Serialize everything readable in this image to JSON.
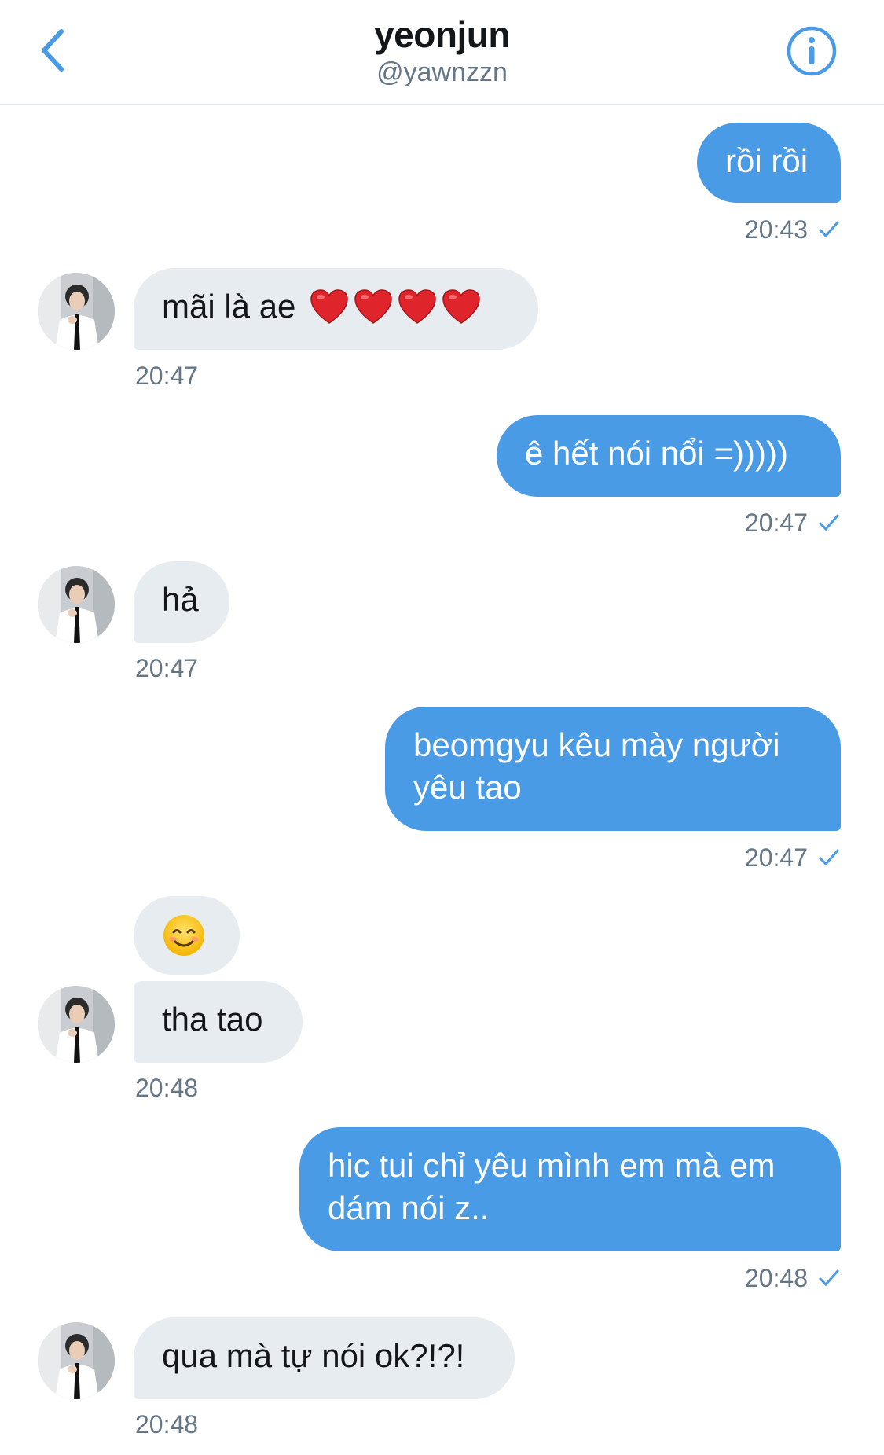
{
  "header": {
    "title": "yeonjun",
    "handle": "@yawnzzn",
    "back_icon": "chevron-left-icon",
    "info_icon": "info-icon",
    "accent_color": "#4a9be6"
  },
  "messages": [
    {
      "side": "out",
      "text": "rồi rồi",
      "time": "20:43"
    },
    {
      "side": "in",
      "text": "mãi là ae",
      "emoji": "heart x4",
      "time": "20:47"
    },
    {
      "side": "out",
      "text": "ê hết nói nổi =)))))",
      "time": "20:47"
    },
    {
      "side": "in",
      "text": "hả",
      "time": "20:47"
    },
    {
      "side": "out",
      "lines": [
        "beomgyu kêu mày người",
        "yêu tao"
      ],
      "time": "20:47"
    },
    {
      "side": "in",
      "emoji": "smiling-face",
      "text": "tha tao",
      "time": "20:48"
    },
    {
      "side": "out",
      "lines": [
        "hic tui chỉ yêu mình em mà em",
        "dám nói z.."
      ],
      "time": "20:48"
    },
    {
      "side": "in",
      "text": "qua mà tự nói ok?!?!",
      "time": "20:48"
    }
  ],
  "colors": {
    "outgoing_bubble": "#4a9be6",
    "incoming_bubble": "#e6ecf0",
    "timestamp": "#657786"
  }
}
